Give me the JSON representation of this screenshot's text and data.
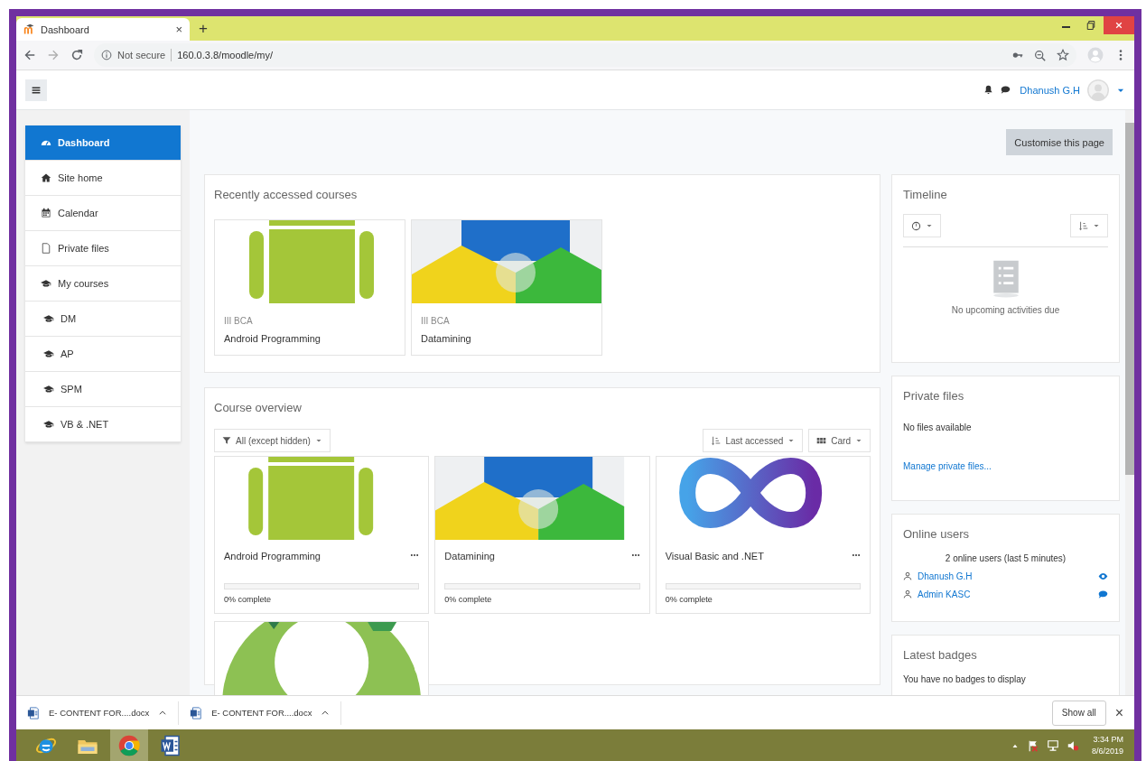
{
  "browser": {
    "tabs": [
      {
        "title": "Dashboard",
        "close": "×",
        "selected": true
      }
    ],
    "new_tab": "+",
    "security": "Not secure",
    "url": "160.0.3.8/moodle/my/"
  },
  "navbar": {
    "user_name": "Dhanush G.H"
  },
  "nav_drawer": {
    "items": [
      {
        "label": "Dashboard",
        "selected": true
      },
      {
        "label": "Site home",
        "selected": false
      },
      {
        "label": "Calendar",
        "selected": false
      },
      {
        "label": "Private files",
        "selected": false
      },
      {
        "label": "My courses",
        "selected": false,
        "children": [
          {
            "label": "DM",
            "selected": false
          },
          {
            "label": "AP",
            "selected": false
          },
          {
            "label": "SPM",
            "selected": false
          },
          {
            "label": "VB & .NET",
            "selected": false
          }
        ]
      }
    ]
  },
  "page_header": {
    "button": "Customise this page"
  },
  "recent_courses": {
    "title": "Recently accessed courses",
    "courses": [
      {
        "category": "III BCA",
        "name": "Android Programming"
      },
      {
        "category": "III BCA",
        "name": "Datamining"
      }
    ]
  },
  "course_overview": {
    "title": "Course overview",
    "filter": "All (except hidden)",
    "sort": "Last accessed",
    "view": "Card",
    "courses": [
      {
        "kind": "full",
        "name": "Android Programming",
        "level": 0,
        "progress": "0% complete"
      },
      {
        "kind": "full",
        "name": "Datamining",
        "level": 0,
        "progress": "0% complete"
      },
      {
        "kind": "full",
        "name": "Visual Basic and .NET",
        "level": 0,
        "progress": "0% complete"
      },
      {
        "kind": "image"
      }
    ]
  },
  "timeline": {
    "title": "Timeline",
    "empty": "No upcoming activities due"
  },
  "private_files": {
    "title": "Private files",
    "empty": "No files available",
    "link": "Manage private files..."
  },
  "online_users": {
    "title": "Online users",
    "summary": "2 online users (last 5 minutes)",
    "users": [
      {
        "name": "Dhanush G.H"
      },
      {
        "name": "Admin KASC"
      }
    ]
  },
  "latest_badges": {
    "title": "Latest badges",
    "empty": "You have no badges to display"
  },
  "downloads": {
    "items": [
      {
        "name": "E- CONTENT FOR....docx"
      },
      {
        "name": "E- CONTENT FOR....docx"
      }
    ],
    "show_all": "Show all",
    "close": "×"
  },
  "taskbar": {
    "apps": [
      {
        "selected": false
      },
      {
        "selected": false
      },
      {
        "selected": true
      },
      {
        "selected": false
      }
    ],
    "time": "3:34 PM",
    "date": "8/6/2019"
  }
}
